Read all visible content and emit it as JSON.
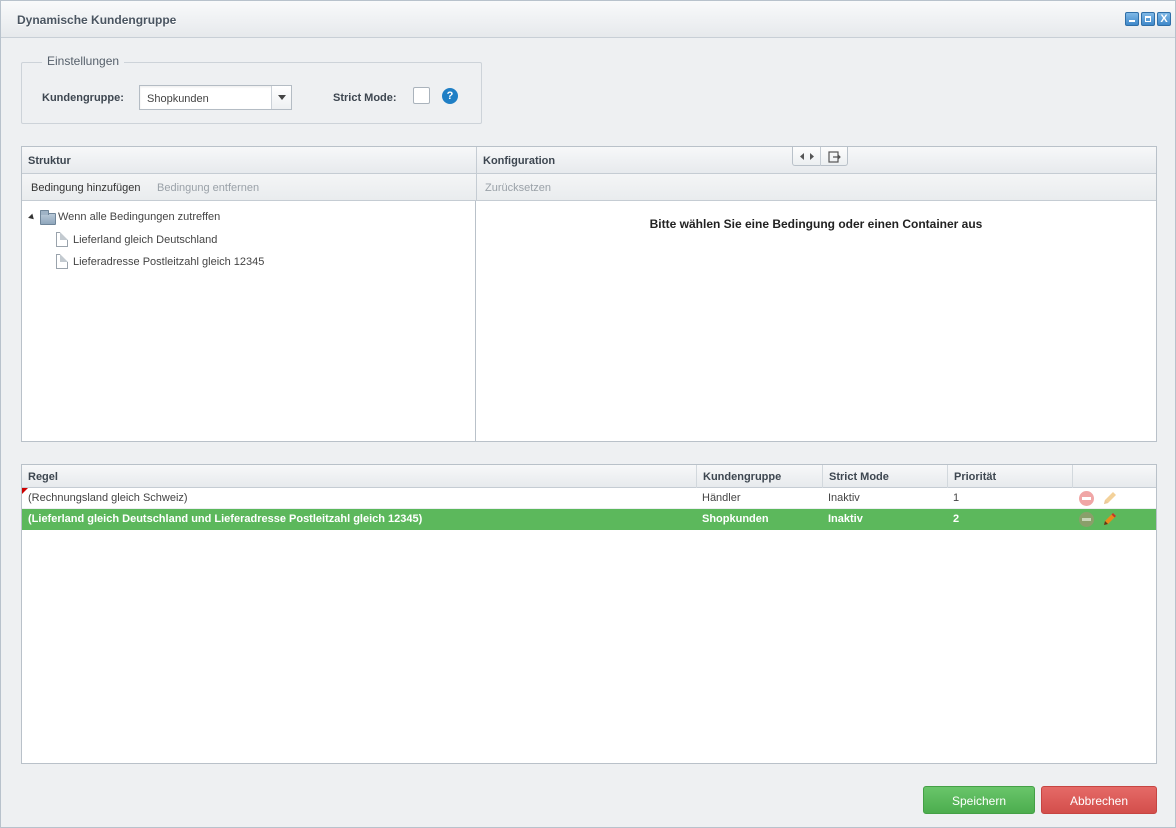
{
  "window": {
    "title": "Dynamische Kundengruppe",
    "controls": [
      "minimize-icon",
      "maximize-icon",
      "close-icon"
    ],
    "close_glyph": "X"
  },
  "settings": {
    "legend": "Einstellungen",
    "customer_group_label": "Kundengruppe:",
    "customer_group_value": "Shopkunden",
    "strict_mode_label": "Strict Mode:",
    "strict_mode_checked": false,
    "help_glyph": "?"
  },
  "structure": {
    "header": "Struktur",
    "add_condition": "Bedingung hinzufügen",
    "remove_condition": "Bedingung entfernen",
    "tree": {
      "root": "Wenn alle Bedingungen zutreffen",
      "children": [
        "Lieferland gleich Deutschland",
        "Lieferadresse Postleitzahl gleich 12345"
      ]
    }
  },
  "configuration": {
    "header": "Konfiguration",
    "reset": "Zurücksetzen",
    "placeholder": "Bitte wählen Sie eine Bedingung oder einen Container aus"
  },
  "rules_grid": {
    "columns": [
      "Regel",
      "Kundengruppe",
      "Strict Mode",
      "Priorität"
    ],
    "rows": [
      {
        "rule": "(Rechnungsland gleich Schweiz)",
        "group": "Händler",
        "strict": "Inaktiv",
        "priority": "1",
        "selected": false,
        "modified": true
      },
      {
        "rule": "(Lieferland gleich Deutschland und Lieferadresse Postleitzahl gleich 12345)",
        "group": "Shopkunden",
        "strict": "Inaktiv",
        "priority": "2",
        "selected": true,
        "modified": false
      }
    ]
  },
  "footer": {
    "save": "Speichern",
    "cancel": "Abbrechen"
  },
  "colors": {
    "selected_row": "#5cb85c",
    "save_button": "#4cad4e",
    "cancel_button": "#d34e4b",
    "help_icon": "#1f7fc5"
  }
}
